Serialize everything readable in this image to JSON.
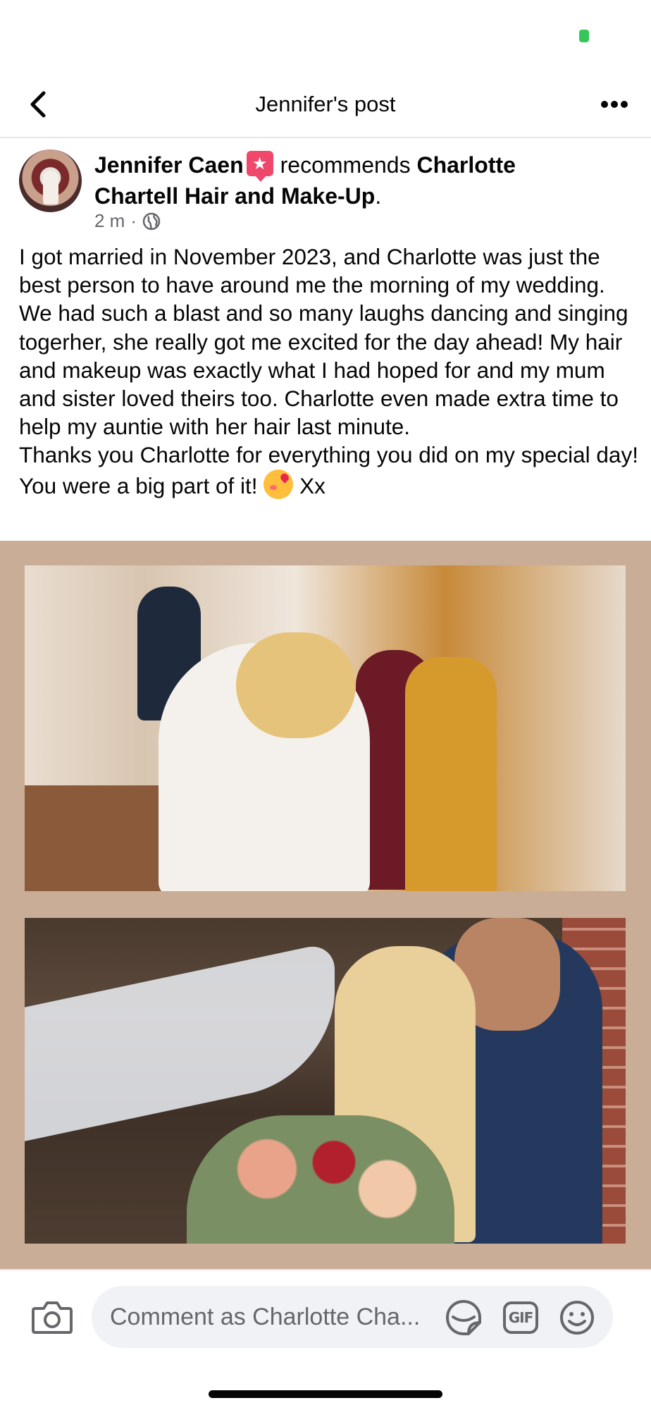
{
  "header": {
    "title": "Jennifer's post",
    "back_icon": "chevron-left-icon",
    "more_icon": "ellipsis-icon"
  },
  "post": {
    "author": "Jennifer Caen",
    "badge_icon": "recommendation-star-icon",
    "verb": "recommends",
    "page_name": "Charlotte Chartell Hair and Make-Up",
    "suffix": ".",
    "time": "2 m",
    "privacy_icon": "globe-icon",
    "body": "I got married in November 2023, and Charlotte was just the best person to have around me the morning of my wedding. We had such a blast and so many laughs dancing and singing togerher, she really got me excited for the day ahead! My hair and makeup was exactly what I had hoped for and my mum and sister loved theirs too. Charlotte even made extra time to help my auntie with her hair last minute.\nThanks you Charlotte for everything you did on my special day! You were a big part of it! ",
    "body_tail": " Xx",
    "emoji": "smiling-face-with-hearts"
  },
  "comment_bar": {
    "placeholder": "Comment as Charlotte Cha...",
    "camera_icon": "camera-icon",
    "sticker_icon": "sticker-icon",
    "gif_label": "GIF",
    "emoji_icon": "smiley-icon"
  },
  "colors": {
    "media_background": "#c9ad96",
    "status_indicator": "#34c759",
    "badge": "#f0486b",
    "secondary_text": "#65676b"
  }
}
